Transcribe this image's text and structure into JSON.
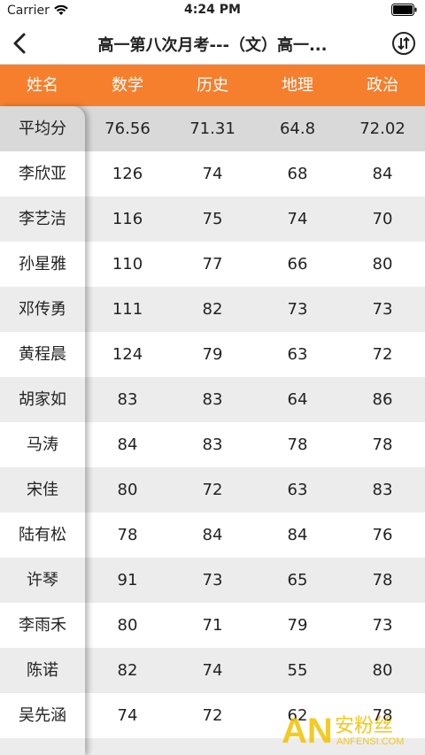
{
  "status_bar": {
    "carrier": "Carrier",
    "time": "4:24 PM"
  },
  "nav": {
    "title": "高一第八次月考---（文）高一..."
  },
  "table": {
    "headers": [
      "姓名",
      "数学",
      "历史",
      "地理",
      "政治"
    ],
    "average": {
      "name": "平均分",
      "values": [
        "76.56",
        "71.31",
        "64.8",
        "72.02"
      ]
    },
    "rows": [
      {
        "name": "李欣亚",
        "values": [
          "126",
          "74",
          "68",
          "84"
        ]
      },
      {
        "name": "李艺洁",
        "values": [
          "116",
          "75",
          "74",
          "70"
        ]
      },
      {
        "name": "孙星雅",
        "values": [
          "110",
          "77",
          "66",
          "80"
        ]
      },
      {
        "name": "邓传勇",
        "values": [
          "111",
          "82",
          "73",
          "73"
        ]
      },
      {
        "name": "黄程晨",
        "values": [
          "124",
          "79",
          "63",
          "72"
        ]
      },
      {
        "name": "胡家如",
        "values": [
          "83",
          "83",
          "64",
          "86"
        ]
      },
      {
        "name": "马涛",
        "values": [
          "84",
          "83",
          "78",
          "78"
        ]
      },
      {
        "name": "宋佳",
        "values": [
          "80",
          "72",
          "63",
          "83"
        ]
      },
      {
        "name": "陆有松",
        "values": [
          "78",
          "84",
          "84",
          "76"
        ]
      },
      {
        "name": "许琴",
        "values": [
          "91",
          "73",
          "65",
          "78"
        ]
      },
      {
        "name": "李雨禾",
        "values": [
          "80",
          "71",
          "79",
          "73"
        ]
      },
      {
        "name": "陈诺",
        "values": [
          "82",
          "74",
          "55",
          "80"
        ]
      },
      {
        "name": "吴先涵",
        "values": [
          "74",
          "72",
          "62",
          "78"
        ]
      }
    ]
  },
  "watermark": {
    "logo": "AN",
    "text": "安粉丝",
    "url": "ANFENSI.COM"
  },
  "colors": {
    "header_bg": "#f57f2c",
    "alt_row": "#ececec",
    "avg_row": "#d9d9d9"
  }
}
